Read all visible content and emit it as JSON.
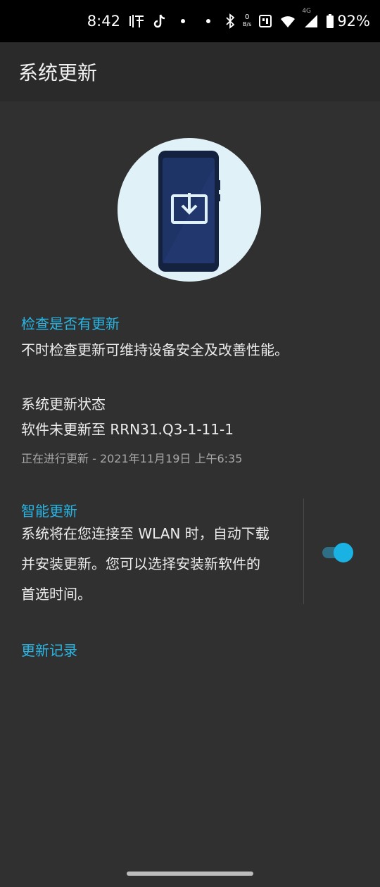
{
  "status_bar": {
    "time": "8:42",
    "data_rate_value": "0",
    "data_rate_unit": "B/s",
    "network_label": "4G",
    "battery": "92%",
    "icons": [
      "listen-icon",
      "tiktok-icon",
      "dot-icon",
      "dot-icon",
      "bluetooth-icon",
      "sim-icon",
      "wifi-icon",
      "signal-icon",
      "battery-icon"
    ]
  },
  "header": {
    "title": "系统更新"
  },
  "check": {
    "title": "检查是否有更新",
    "description": "不时检查更新可维持设备安全及改善性能。"
  },
  "status": {
    "title": "系统更新状态",
    "version_text": "软件未更新至 RRN31.Q3-1-11-1",
    "progress_text": "正在进行更新 - 2021年11月19日 上午6:35"
  },
  "smart_update": {
    "title": "智能更新",
    "line1": "系统将在您连接至 WLAN 时，自动下载",
    "line2": "并安装更新。您可以选择安装新软件的",
    "line3": "首选时间。",
    "enabled": true
  },
  "history": {
    "label": "更新记录"
  },
  "colors": {
    "accent": "#29b6e5",
    "background": "#303030",
    "appbar": "#2a2a2a",
    "hero_circle": "#e0f2f8",
    "phone_body": "#1f2f5c"
  }
}
